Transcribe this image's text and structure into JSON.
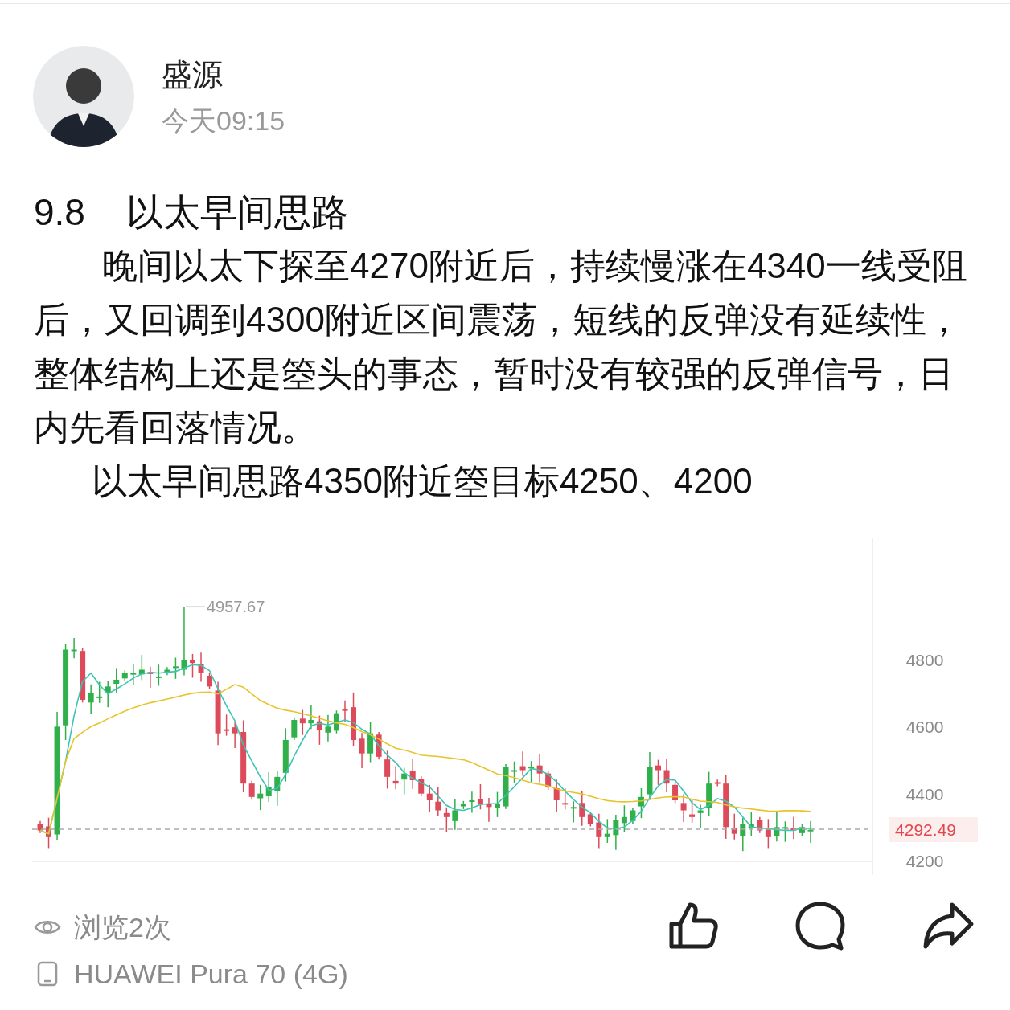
{
  "author": {
    "name": "盛源",
    "time": "今天09:15"
  },
  "post": {
    "title": "9.8    以太早间思路",
    "paragraphs": [
      "晚间以太下探至4270附近后，持续慢涨在4340一线受阻后，又回调到4300附近区间震荡，短线的反弹没有延续性，整体结构上还是箜头的事态，暂时没有较强的反弹信号，日内先看回落情况。",
      "以太早间思路4350附近箜目标4250、4200"
    ]
  },
  "chart": {
    "high_label": "4957.67",
    "y_axis_labels": [
      "4800",
      "4600",
      "4400",
      "4200"
    ],
    "last_price": "4292.49"
  },
  "footer": {
    "views": "浏览2次",
    "device": "HUAWEI Pura 70 (4G)"
  }
}
